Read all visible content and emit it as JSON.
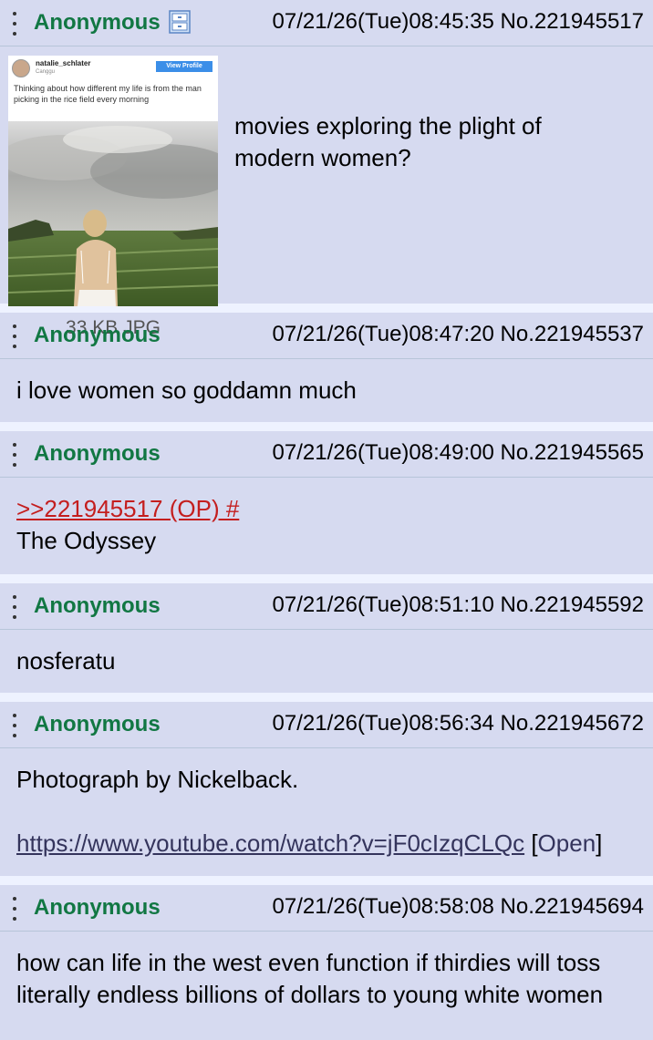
{
  "posts": [
    {
      "name": "Anonymous",
      "datetime": "07/21/26(Tue)08:45:35",
      "no": "No.221945517",
      "text_lines": [
        "movies exploring the plight of",
        "modern women?"
      ],
      "file": {
        "meta": "33 KB JPG",
        "icon": "file-info-icon",
        "thumb": {
          "username": "natalie_schlater",
          "location": "Canggu",
          "button": "View Profile",
          "caption": "Thinking about how different my life is from the man picking in the rice field every morning"
        }
      }
    },
    {
      "name": "Anonymous",
      "datetime": "07/21/26(Tue)08:47:20",
      "no": "No.221945537",
      "text": "i love women so goddamn much"
    },
    {
      "name": "Anonymous",
      "datetime": "07/21/26(Tue)08:49:00",
      "no": "No.221945565",
      "quote": ">>221945517 (OP) #",
      "text": "The Odyssey"
    },
    {
      "name": "Anonymous",
      "datetime": "07/21/26(Tue)08:51:10",
      "no": "No.221945592",
      "text": "nosferatu"
    },
    {
      "name": "Anonymous",
      "datetime": "07/21/26(Tue)08:56:34",
      "no": "No.221945672",
      "text": "Photograph by Nickelback.",
      "link": "https://www.youtube.com/watch?v=jF0cIzqCLQc",
      "link_open_label": "Open",
      "bracket_left": "[",
      "bracket_right": "]"
    },
    {
      "name": "Anonymous",
      "datetime": "07/21/26(Tue)08:58:08",
      "no": "No.221945694",
      "text_lines": [
        "how can life in the west even function if thirdies will toss",
        "literally endless billions of dollars to young white women"
      ]
    }
  ],
  "colors": {
    "post_bg": "#d6daf0",
    "page_bg": "#eef2ff",
    "name": "#117743",
    "quote": "#c41e1e",
    "link": "#34345c"
  }
}
